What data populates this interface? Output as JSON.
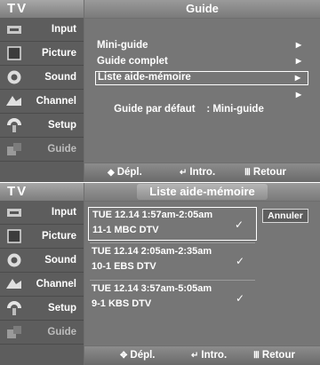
{
  "screen1": {
    "tv_label": "TV",
    "title": "Guide",
    "sidebar": [
      {
        "label": "Input",
        "icon": "input-icon"
      },
      {
        "label": "Picture",
        "icon": "picture-icon"
      },
      {
        "label": "Sound",
        "icon": "sound-icon"
      },
      {
        "label": "Channel",
        "icon": "channel-icon"
      },
      {
        "label": "Setup",
        "icon": "setup-icon"
      },
      {
        "label": "Guide",
        "icon": "guide-icon"
      }
    ],
    "menu": [
      {
        "label": "Mini-guide",
        "arrow": "▶"
      },
      {
        "label": "Guide complet",
        "arrow": "▶"
      },
      {
        "label": "Liste aide-mémoire",
        "arrow": "▶",
        "selected": true
      },
      {
        "label": "Guide par défaut    : Mini-guide",
        "arrow": "▶"
      }
    ],
    "bottom": {
      "move_icon": "◆",
      "move": "Dépl.",
      "enter_icon": "↵",
      "enter": "Intro.",
      "return_icon": "Ⅲ",
      "return": "Retour"
    }
  },
  "screen2": {
    "tv_label": "TV",
    "title": "Liste aide-mémoire",
    "sidebar": [
      {
        "label": "Input",
        "icon": "input-icon"
      },
      {
        "label": "Picture",
        "icon": "picture-icon"
      },
      {
        "label": "Sound",
        "icon": "sound-icon"
      },
      {
        "label": "Channel",
        "icon": "channel-icon"
      },
      {
        "label": "Setup",
        "icon": "setup-icon"
      },
      {
        "label": "Guide",
        "icon": "guide-icon"
      }
    ],
    "reminders": [
      {
        "time": "TUE  12.14  1:57am-2:05am",
        "channel": "11-1  MBC  DTV",
        "check": "✓",
        "selected": true
      },
      {
        "time": "TUE  12.14  2:05am-2:35am",
        "channel": "10-1  EBS  DTV",
        "check": "✓"
      },
      {
        "time": "TUE  12.14  3:57am-5:05am",
        "channel": "9-1  KBS  DTV",
        "check": "✓"
      }
    ],
    "cancel": "Annuler",
    "bottom": {
      "move_icon": "✥",
      "move": "Dépl.",
      "enter_icon": "↵",
      "enter": "Intro.",
      "return_icon": "Ⅲ",
      "return": "Retour"
    }
  }
}
